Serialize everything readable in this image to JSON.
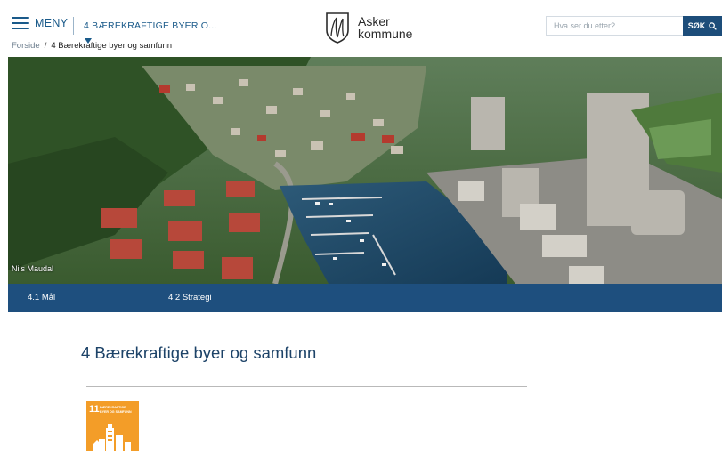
{
  "header": {
    "menu_label": "MENY",
    "section_link": "4 BÆREKRAFTIGE BYER O...",
    "logo_line1": "Asker",
    "logo_line2": "kommune"
  },
  "breadcrumb": {
    "home": "Forside",
    "separator": "/",
    "current": "4 Bærekraftige byer og samfunn"
  },
  "search": {
    "placeholder": "Hva ser du etter?",
    "button_label": "SØK"
  },
  "hero": {
    "photo_credit": "Nils Maudal"
  },
  "tabs": [
    {
      "label": "4.1 Mål"
    },
    {
      "label": "4.2 Strategi"
    }
  ],
  "main": {
    "title": "4 Bærekraftige byer og samfunn"
  },
  "sdg_badge": {
    "number": "11",
    "text_line1": "BÆREKRAFTIGE",
    "text_line2": "BYER OG SAMFUNN",
    "color": "#f39d28"
  },
  "colors": {
    "brand_blue": "#1e4f7e",
    "link_blue": "#1a5a8a",
    "title_blue": "#1d4368"
  }
}
